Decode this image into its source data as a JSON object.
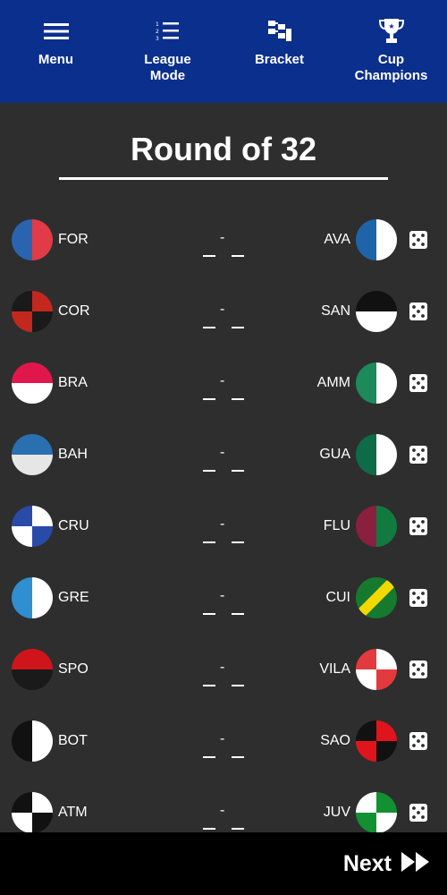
{
  "nav": [
    {
      "id": "menu",
      "label": "Menu",
      "icon": "hamburger-icon"
    },
    {
      "id": "league",
      "label": "League\nMode",
      "icon": "numbered-list-icon"
    },
    {
      "id": "bracket",
      "label": "Bracket",
      "icon": "bracket-icon"
    },
    {
      "id": "cup",
      "label": "Cup\nChampions",
      "icon": "trophy-icon"
    }
  ],
  "round_title": "Round of 32",
  "score_placeholder": "-",
  "matches": [
    {
      "home": "FOR",
      "away": "AVA",
      "home_flag": "vsplit:#2a64b0,#e03b46",
      "away_flag": "vsplit:#1f63a8,#ffffff"
    },
    {
      "home": "COR",
      "away": "SAN",
      "home_flag": "quarters:#1a1a1a,#c3271d",
      "away_flag": "hsplit:#111111,#ffffff"
    },
    {
      "home": "BRA",
      "away": "AMM",
      "home_flag": "hsplit:#e0174a,#ffffff",
      "away_flag": "vsplit:#1c8a5a,#ffffff"
    },
    {
      "home": "BAH",
      "away": "GUA",
      "home_flag": "hsplit:#2a6fb0,#e6e6e6",
      "away_flag": "vsplit:#0e6b47,#ffffff"
    },
    {
      "home": "CRU",
      "away": "FLU",
      "home_flag": "quarters:#2a4aa8,#ffffff",
      "away_flag": "vsplit:#8b1f3e,#137a3f"
    },
    {
      "home": "GRE",
      "away": "CUI",
      "home_flag": "vsplit:#2f8fd0,#ffffff",
      "away_flag": "diag:#157a2e,#f1d800"
    },
    {
      "home": "SPO",
      "away": "VILA",
      "home_flag": "hsplit:#d0141c,#1a1a1a",
      "away_flag": "quarters:#e33a3d,#ffffff"
    },
    {
      "home": "BOT",
      "away": "SAO",
      "home_flag": "vsplit:#111111,#ffffff",
      "away_flag": "quarters:#111111,#e0141c"
    },
    {
      "home": "ATM",
      "away": "JUV",
      "home_flag": "quarters:#111111,#ffffff",
      "away_flag": "quarters:#ffffff,#129132"
    }
  ],
  "next_label": "Next",
  "colors": {
    "nav_bg": "#0b2f8c",
    "page_bg": "#2e2e2e",
    "bottom_bg": "#000000"
  }
}
